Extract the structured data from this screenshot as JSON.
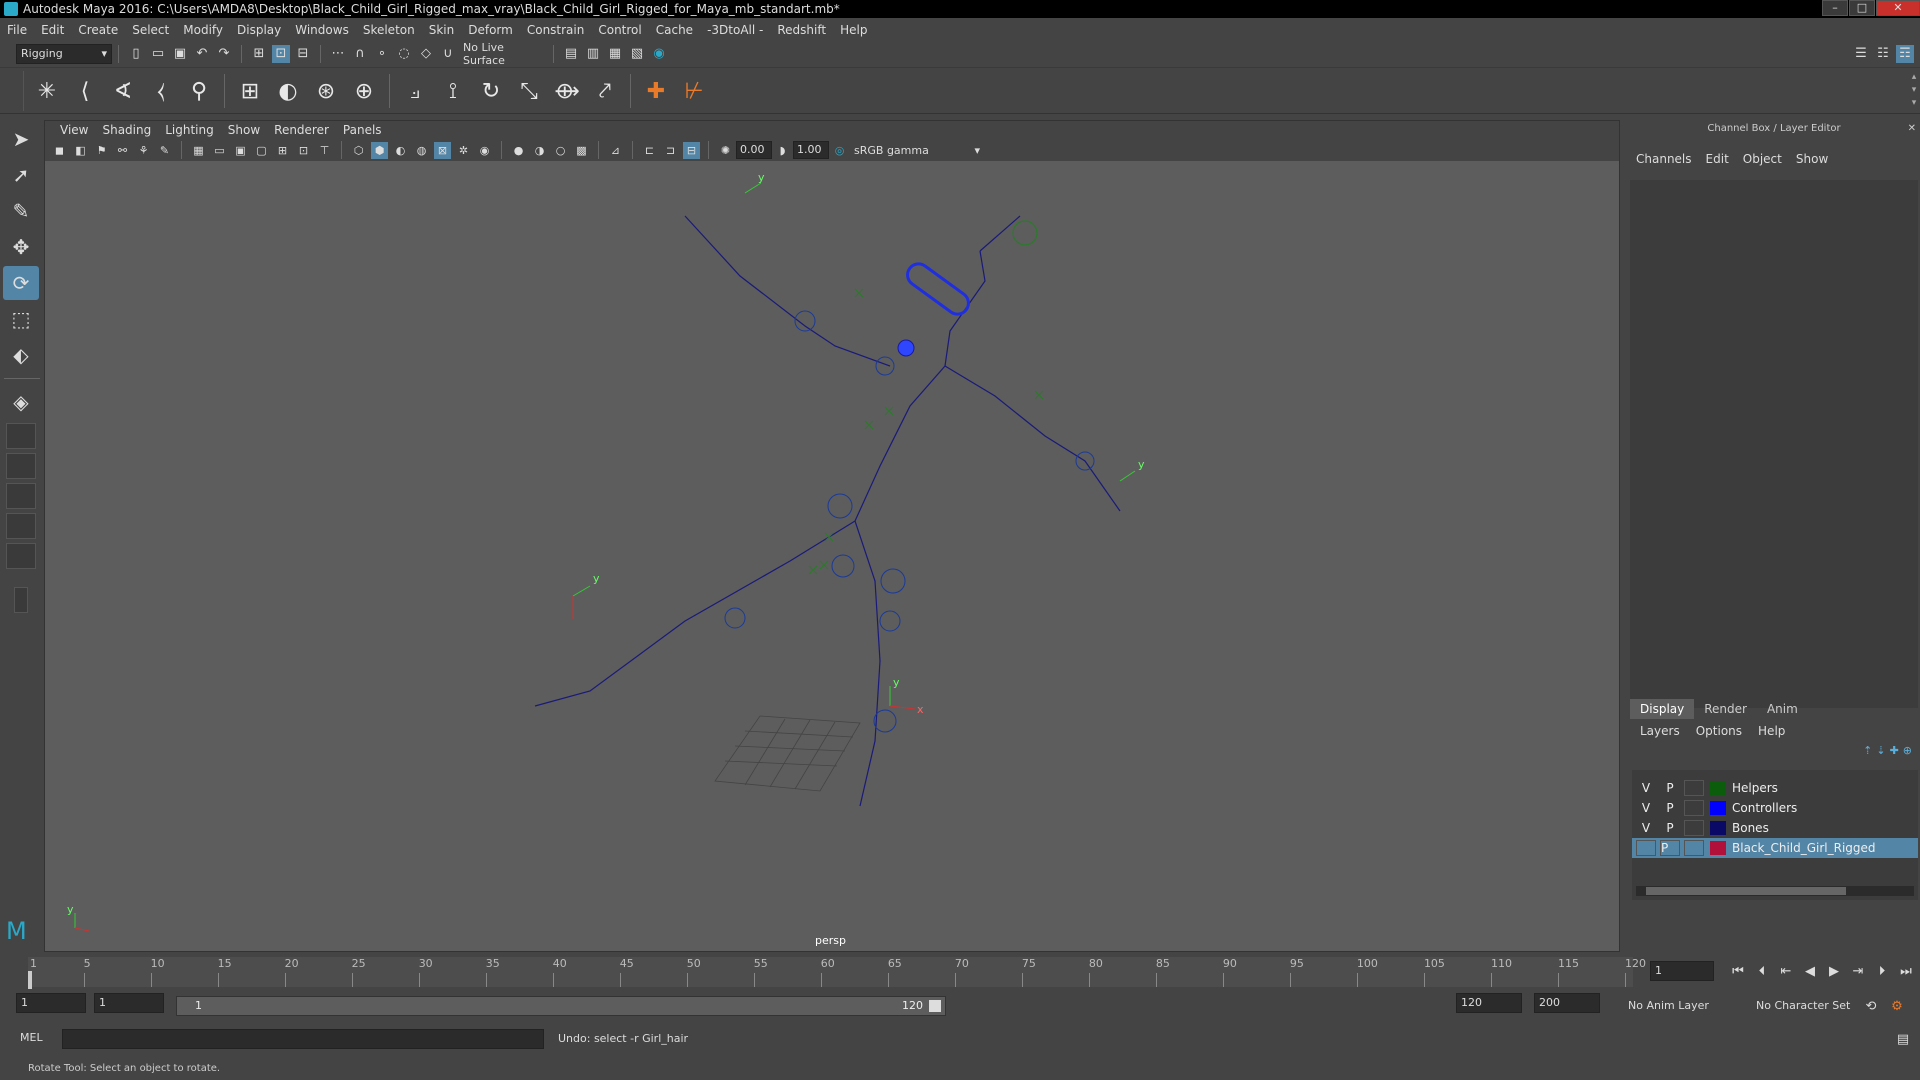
{
  "title": "Autodesk Maya 2016: C:\\Users\\AMDA8\\Desktop\\Black_Child_Girl_Rigged_max_vray\\Black_Child_Girl_Rigged_for_Maya_mb_standart.mb*",
  "menubar": [
    "File",
    "Edit",
    "Create",
    "Select",
    "Modify",
    "Display",
    "Windows",
    "Skeleton",
    "Skin",
    "Deform",
    "Constrain",
    "Control",
    "Cache",
    "-3DtoAll -",
    "Redshift",
    "Help"
  ],
  "status": {
    "menuset": "Rigging",
    "live_surface": "No Live Surface"
  },
  "viewport": {
    "menu": [
      "View",
      "Shading",
      "Lighting",
      "Show",
      "Renderer",
      "Panels"
    ],
    "near": "0.00",
    "far": "1.00",
    "colorspace": "sRGB gamma",
    "camera": "persp"
  },
  "channelbox": {
    "title": "Channel Box / Layer Editor",
    "menu": [
      "Channels",
      "Edit",
      "Object",
      "Show"
    ]
  },
  "layer_editor": {
    "tabs": [
      "Display",
      "Render",
      "Anim"
    ],
    "menu": [
      "Layers",
      "Options",
      "Help"
    ],
    "layers": [
      {
        "v": "V",
        "p": "P",
        "name": "Helpers",
        "color": "#0b5c0b"
      },
      {
        "v": "V",
        "p": "P",
        "name": "Controllers",
        "color": "#0000ff"
      },
      {
        "v": "V",
        "p": "P",
        "name": "Bones",
        "color": "#0a0a66"
      },
      {
        "v": "",
        "p": "P",
        "name": "Black_Child_Girl_Rigged",
        "color": "#b0103a"
      }
    ]
  },
  "timeline": {
    "ticks": [
      "1",
      "5",
      "10",
      "15",
      "20",
      "25",
      "30",
      "35",
      "40",
      "45",
      "50",
      "55",
      "60",
      "65",
      "70",
      "75",
      "80",
      "85",
      "90",
      "95",
      "100",
      "105",
      "110",
      "115",
      "120"
    ],
    "current_frame": "1"
  },
  "range": {
    "start": "1",
    "start2": "1",
    "slider_start": "1",
    "slider_end": "120",
    "end": "120",
    "end2": "200",
    "anim_layer": "No Anim Layer",
    "char_set": "No Character Set"
  },
  "cmd": {
    "lang": "MEL",
    "result": "Undo: select -r Girl_hair"
  },
  "help": "Rotate Tool: Select an object to rotate."
}
